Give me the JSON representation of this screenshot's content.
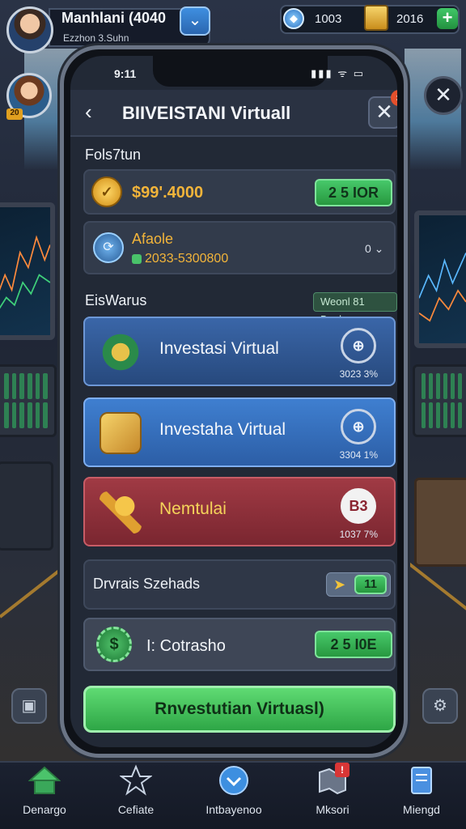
{
  "hud": {
    "player_name": "Manhlani (4040",
    "player_sub_prefix": "",
    "player_sub": "Ezzhon 3.Suhn",
    "friend_badge": "20",
    "gems": "1003",
    "gold": "2016",
    "plus": "+"
  },
  "phone": {
    "time": "9:11",
    "status_icons": "▮▮▮ ᯤ ▭"
  },
  "header": {
    "title": "BIIVEISTANI Virtuall"
  },
  "balance_section": {
    "label": "Fols7tun",
    "balance_value": "$99'.4000",
    "balance_button": "2 5 IOR",
    "asset_name": "Afaole",
    "asset_value": "2033-5300800",
    "asset_change": "0 ⌄"
  },
  "investments_section": {
    "label": "EisWarus",
    "tag": "Weonl 81 Beole",
    "cards": [
      {
        "title": "Investasi Virtual",
        "badge": "⊕",
        "pct": "3023 3%",
        "style": "blue1"
      },
      {
        "title": "Investaha Virtual",
        "badge": "⊕",
        "pct": "3304 1%",
        "style": "blue2"
      },
      {
        "title": "Nemtulai",
        "badge": "B3",
        "pct": "1037 7%",
        "style": "red"
      }
    ]
  },
  "bonus_row": {
    "label": "Drvrais Szehads",
    "counter": "11"
  },
  "cash_row": {
    "icon": "$",
    "label": "I: Cotrasho",
    "button": "2 5 I0E"
  },
  "cta": {
    "label": "Rnvestutian Virtuasl)"
  },
  "nav": [
    {
      "label": "Denargo",
      "icon": "house-icon"
    },
    {
      "label": "Cefiate",
      "icon": "star-icon"
    },
    {
      "label": "Intbayenoo",
      "icon": "chevron-badge-icon"
    },
    {
      "label": "Mksori",
      "icon": "map-icon",
      "notify": "!"
    },
    {
      "label": "Miengd",
      "icon": "document-icon"
    }
  ],
  "colors": {
    "accent_green": "#47c86a",
    "gold_text": "#f2b43a",
    "card_blue": "#3a66a8",
    "card_red": "#a03a44"
  }
}
